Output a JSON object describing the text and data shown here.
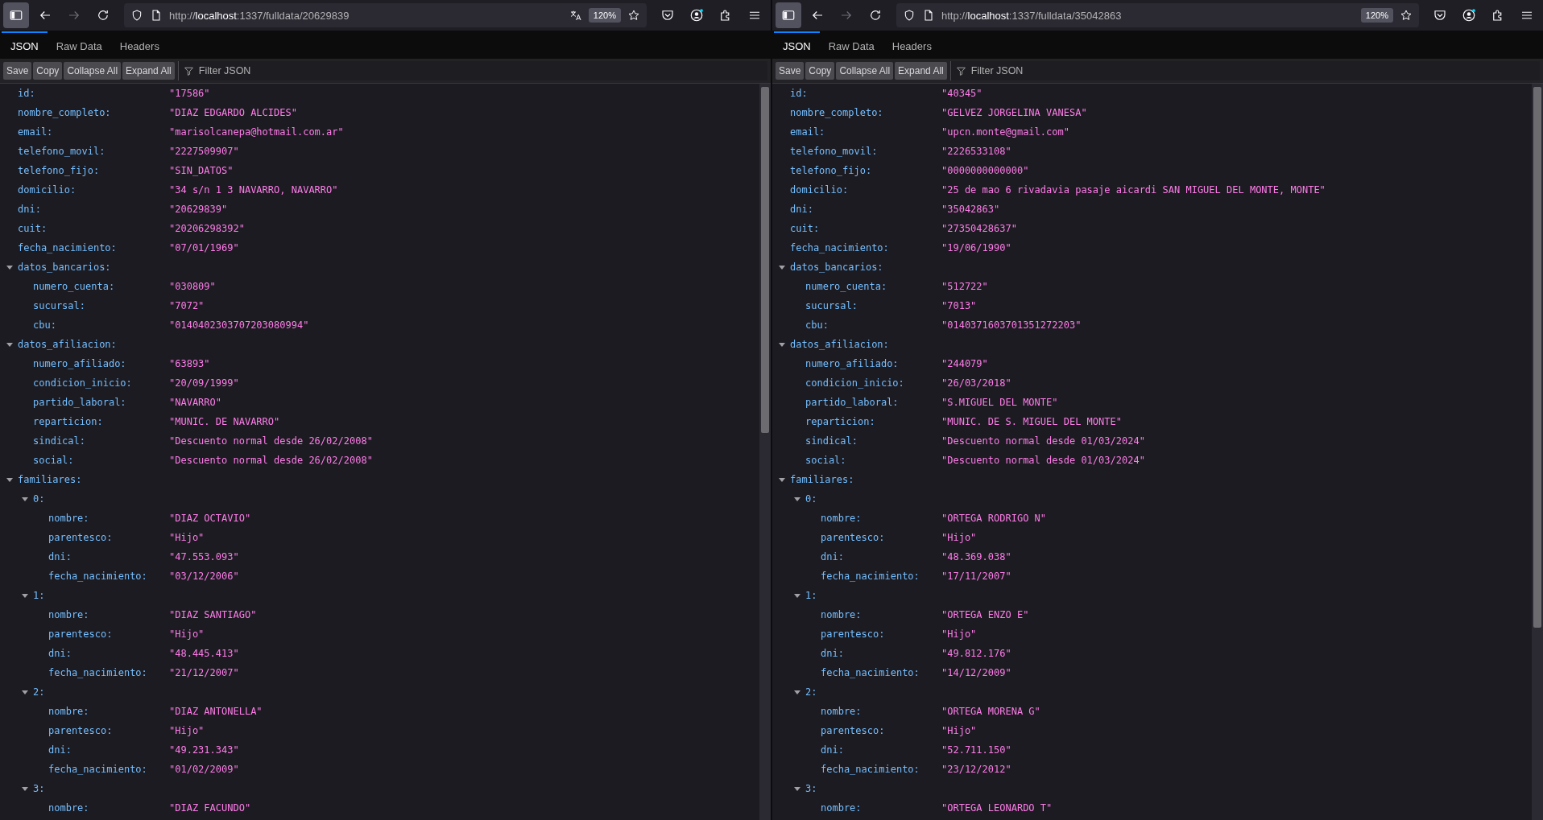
{
  "windows": [
    {
      "url": "http://**localhost**:1337/fulldata/20629839",
      "translate_available": true,
      "zoom": "120%",
      "tabs": [
        {
          "label": "JSON",
          "selected": true
        },
        {
          "label": "Raw Data",
          "selected": false
        },
        {
          "label": "Headers",
          "selected": false
        }
      ],
      "buttons": [
        "Save",
        "Copy",
        "Collapse All",
        "Expand All"
      ],
      "filter": {
        "placeholder": "Filter JSON"
      },
      "nodes": [
        {
          "key": "id:",
          "value": "\"17586\""
        },
        {
          "key": "nombre_completo:",
          "value": "\"DIAZ EDGARDO ALCIDES\""
        },
        {
          "key": "email:",
          "value": "\"marisolcanepa@hotmail.com.ar\""
        },
        {
          "key": "telefono_movil:",
          "value": "\"2227509907\""
        },
        {
          "key": "telefono_fijo:",
          "value": "\"SIN_DATOS\""
        },
        {
          "key": "domicilio:",
          "value": "\"34 s/n 1 3 NAVARRO, NAVARRO\""
        },
        {
          "key": "dni:",
          "value": "\"20629839\""
        },
        {
          "key": "cuit:",
          "value": "\"20206298392\""
        },
        {
          "key": "fecha_nacimiento:",
          "value": "\"07/01/1969\""
        },
        {
          "key": "datos_bancarios:",
          "expanded": true,
          "children": [
            {
              "key": "numero_cuenta:",
              "value": "\"030809\""
            },
            {
              "key": "sucursal:",
              "value": "\"7072\""
            },
            {
              "key": "cbu:",
              "value": "\"0140402303707203080994\""
            }
          ]
        },
        {
          "key": "datos_afiliacion:",
          "expanded": true,
          "children": [
            {
              "key": "numero_afiliado:",
              "value": "\"63893\""
            },
            {
              "key": "condicion_inicio:",
              "value": "\"20/09/1999\""
            },
            {
              "key": "partido_laboral:",
              "value": "\"NAVARRO\""
            },
            {
              "key": "reparticion:",
              "value": "\"MUNIC. DE NAVARRO\""
            },
            {
              "key": "sindical:",
              "value": "\"Descuento normal desde 26/02/2008\""
            },
            {
              "key": "social:",
              "value": "\"Descuento normal desde 26/02/2008\""
            }
          ]
        },
        {
          "key": "familiares:",
          "expanded": true,
          "children": [
            {
              "key": "0:",
              "expanded": true,
              "children": [
                {
                  "key": "nombre:",
                  "value": "\"DIAZ OCTAVIO\""
                },
                {
                  "key": "parentesco:",
                  "value": "\"Hijo\""
                },
                {
                  "key": "dni:",
                  "value": "\"47.553.093\""
                },
                {
                  "key": "fecha_nacimiento:",
                  "value": "\"03/12/2006\""
                }
              ]
            },
            {
              "key": "1:",
              "expanded": true,
              "children": [
                {
                  "key": "nombre:",
                  "value": "\"DIAZ SANTIAGO\""
                },
                {
                  "key": "parentesco:",
                  "value": "\"Hijo\""
                },
                {
                  "key": "dni:",
                  "value": "\"48.445.413\""
                },
                {
                  "key": "fecha_nacimiento:",
                  "value": "\"21/12/2007\""
                }
              ]
            },
            {
              "key": "2:",
              "expanded": true,
              "children": [
                {
                  "key": "nombre:",
                  "value": "\"DIAZ ANTONELLA\""
                },
                {
                  "key": "parentesco:",
                  "value": "\"Hijo\""
                },
                {
                  "key": "dni:",
                  "value": "\"49.231.343\""
                },
                {
                  "key": "fecha_nacimiento:",
                  "value": "\"01/02/2009\""
                }
              ]
            },
            {
              "key": "3:",
              "expanded": true,
              "children": [
                {
                  "key": "nombre:",
                  "value": "\"DIAZ FACUNDO\""
                }
              ]
            }
          ]
        }
      ]
    },
    {
      "url": "http://**localhost**:1337/fulldata/35042863",
      "translate_available": false,
      "zoom": "120%",
      "tabs": [
        {
          "label": "JSON",
          "selected": true
        },
        {
          "label": "Raw Data",
          "selected": false
        },
        {
          "label": "Headers",
          "selected": false
        }
      ],
      "buttons": [
        "Save",
        "Copy",
        "Collapse All",
        "Expand All"
      ],
      "filter": {
        "placeholder": "Filter JSON"
      },
      "nodes": [
        {
          "key": "id:",
          "value": "\"40345\""
        },
        {
          "key": "nombre_completo:",
          "value": "\"GELVEZ JORGELINA VANESA\""
        },
        {
          "key": "email:",
          "value": "\"upcn.monte@gmail.com\""
        },
        {
          "key": "telefono_movil:",
          "value": "\"2226533108\""
        },
        {
          "key": "telefono_fijo:",
          "value": "\"0000000000000\""
        },
        {
          "key": "domicilio:",
          "value": "\"25 de mao 6 rivadavia pasaje aicardi SAN MIGUEL DEL MONTE, MONTE\""
        },
        {
          "key": "dni:",
          "value": "\"35042863\""
        },
        {
          "key": "cuit:",
          "value": "\"27350428637\""
        },
        {
          "key": "fecha_nacimiento:",
          "value": "\"19/06/1990\""
        },
        {
          "key": "datos_bancarios:",
          "expanded": true,
          "children": [
            {
              "key": "numero_cuenta:",
              "value": "\"512722\""
            },
            {
              "key": "sucursal:",
              "value": "\"7013\""
            },
            {
              "key": "cbu:",
              "value": "\"0140371603701351272203\""
            }
          ]
        },
        {
          "key": "datos_afiliacion:",
          "expanded": true,
          "children": [
            {
              "key": "numero_afiliado:",
              "value": "\"244079\""
            },
            {
              "key": "condicion_inicio:",
              "value": "\"26/03/2018\""
            },
            {
              "key": "partido_laboral:",
              "value": "\"S.MIGUEL DEL MONTE\""
            },
            {
              "key": "reparticion:",
              "value": "\"MUNIC. DE S. MIGUEL DEL MONTE\""
            },
            {
              "key": "sindical:",
              "value": "\"Descuento normal desde 01/03/2024\""
            },
            {
              "key": "social:",
              "value": "\"Descuento normal desde 01/03/2024\""
            }
          ]
        },
        {
          "key": "familiares:",
          "expanded": true,
          "children": [
            {
              "key": "0:",
              "expanded": true,
              "children": [
                {
                  "key": "nombre:",
                  "value": "\"ORTEGA RODRIGO N\""
                },
                {
                  "key": "parentesco:",
                  "value": "\"Hijo\""
                },
                {
                  "key": "dni:",
                  "value": "\"48.369.038\""
                },
                {
                  "key": "fecha_nacimiento:",
                  "value": "\"17/11/2007\""
                }
              ]
            },
            {
              "key": "1:",
              "expanded": true,
              "children": [
                {
                  "key": "nombre:",
                  "value": "\"ORTEGA ENZO E\""
                },
                {
                  "key": "parentesco:",
                  "value": "\"Hijo\""
                },
                {
                  "key": "dni:",
                  "value": "\"49.812.176\""
                },
                {
                  "key": "fecha_nacimiento:",
                  "value": "\"14/12/2009\""
                }
              ]
            },
            {
              "key": "2:",
              "expanded": true,
              "children": [
                {
                  "key": "nombre:",
                  "value": "\"ORTEGA MORENA G\""
                },
                {
                  "key": "parentesco:",
                  "value": "\"Hijo\""
                },
                {
                  "key": "dni:",
                  "value": "\"52.711.150\""
                },
                {
                  "key": "fecha_nacimiento:",
                  "value": "\"23/12/2012\""
                }
              ]
            },
            {
              "key": "3:",
              "expanded": true,
              "children": [
                {
                  "key": "nombre:",
                  "value": "\"ORTEGA LEONARDO T\""
                }
              ]
            }
          ]
        }
      ]
    }
  ]
}
